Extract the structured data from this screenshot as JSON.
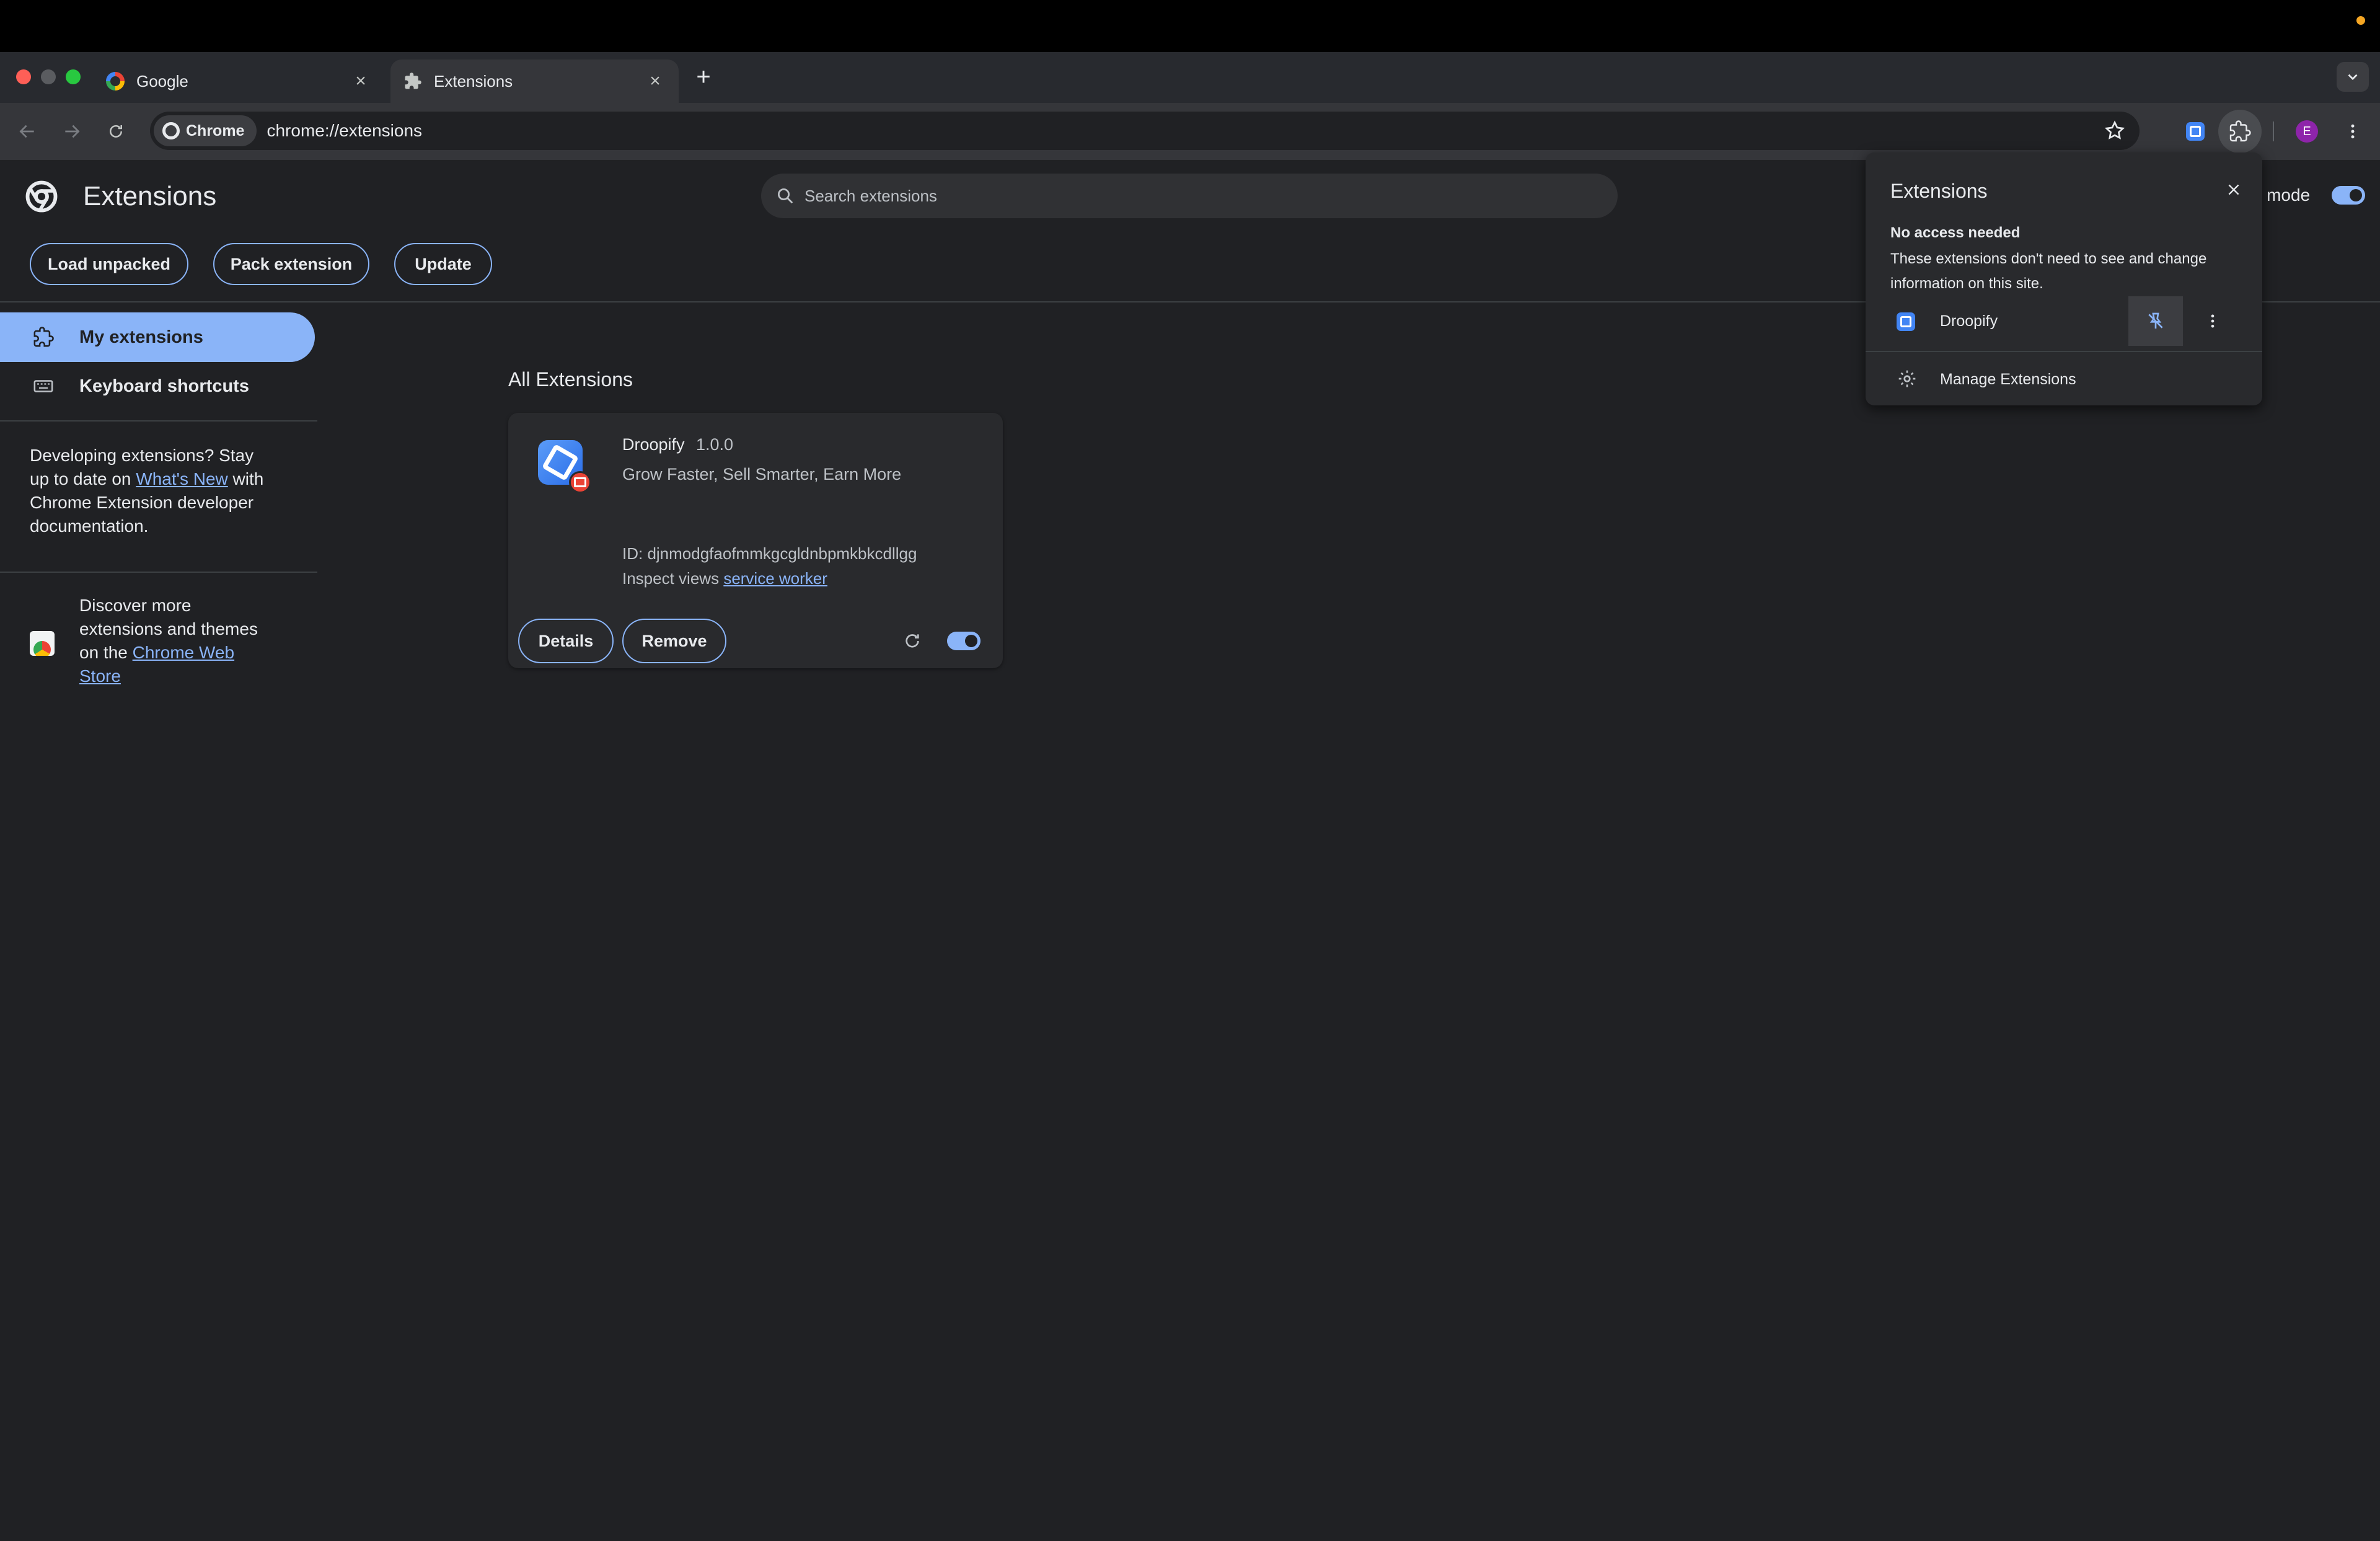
{
  "browser": {
    "tabs": [
      {
        "title": "Google",
        "icon": "google-icon",
        "active": false
      },
      {
        "title": "Extensions",
        "icon": "puzzle-icon",
        "active": true
      }
    ],
    "address_chip": "Chrome",
    "url": "chrome://extensions",
    "profile_initial": "E"
  },
  "page": {
    "title": "Extensions",
    "search_placeholder": "Search extensions",
    "dev_mode_label": "r mode",
    "dev_mode_on": true,
    "actions": {
      "load_unpacked": "Load unpacked",
      "pack_extension": "Pack extension",
      "update": "Update"
    }
  },
  "sidebar": {
    "items": [
      {
        "label": "My extensions",
        "icon": "extension-icon",
        "selected": true
      },
      {
        "label": "Keyboard shortcuts",
        "icon": "keyboard-icon",
        "selected": false
      }
    ],
    "dev_text_1": "Developing extensions? Stay",
    "dev_text_2": "up to date on",
    "whats_new_link": "What's New",
    "dev_text_3": "with",
    "dev_text_4": "Chrome Extension developer",
    "dev_text_5": "documentation.",
    "discover_1": "Discover more",
    "discover_2": "extensions and themes",
    "discover_3": "on the",
    "webstore_link_1": "Chrome Web",
    "webstore_link_2": "Store"
  },
  "main": {
    "section_title": "All Extensions",
    "extension": {
      "name": "Droopify",
      "version": "1.0.0",
      "description": "Grow Faster, Sell Smarter, Earn More",
      "id_line": "ID: djnmodgfaofmmkgcgldnbpmkbkcdllgg",
      "inspect_label": "Inspect views",
      "inspect_link": "service worker",
      "details_label": "Details",
      "remove_label": "Remove",
      "enabled": true
    }
  },
  "popup": {
    "title": "Extensions",
    "section_heading": "No access needed",
    "section_desc": "These extensions don't need to see and change information on this site.",
    "items": [
      {
        "name": "Droopify",
        "pinned": true
      }
    ],
    "manage_label": "Manage Extensions"
  },
  "colors": {
    "accent": "#8ab4f8",
    "background": "#202124",
    "card": "#292a2d"
  }
}
